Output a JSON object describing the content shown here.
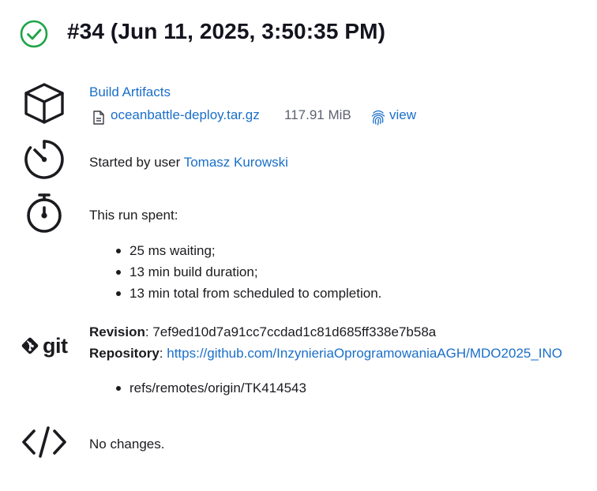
{
  "header": {
    "title": "#34 (Jun 11, 2025, 3:50:35 PM)",
    "status_color": "#1ea446"
  },
  "artifacts": {
    "heading": "Build Artifacts",
    "file_name": "oceanbattle-deploy.tar.gz",
    "file_size": "117.91 MiB",
    "view_label": "view"
  },
  "cause": {
    "prefix": "Started by user ",
    "user": "Tomasz Kurowski"
  },
  "timing": {
    "intro": "This run spent:",
    "items": [
      "25 ms waiting;",
      "13 min build duration;",
      "13 min total from scheduled to completion."
    ]
  },
  "git": {
    "logo_text": "git",
    "revision_label": "Revision",
    "revision_value": "7ef9ed10d7a91cc7ccdad1c81d685ff338e7b58a",
    "repository_label": "Repository",
    "repository_url": "https://github.com/InzynieriaOprogramowaniaAGH/MDO2025_INO",
    "branches": [
      "refs/remotes/origin/TK414543"
    ]
  },
  "changes": {
    "text": "No changes."
  },
  "icons": {
    "status": "check-circle-icon",
    "artifacts": "cube-icon",
    "file": "document-icon",
    "view": "fingerprint-icon",
    "cause": "timer-icon",
    "timing": "stopwatch-icon",
    "git": "git-logo-icon",
    "changes": "code-icon"
  }
}
